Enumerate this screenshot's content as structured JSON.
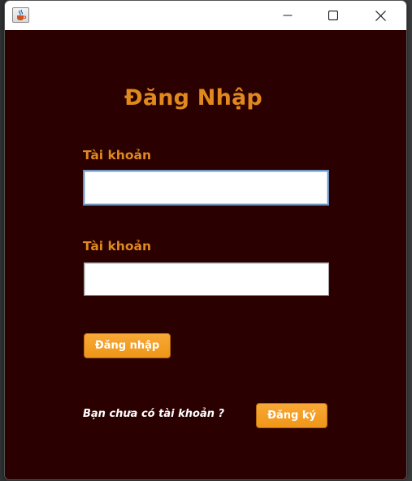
{
  "window": {
    "title": "",
    "icon": "java-cup-icon"
  },
  "titlebar_buttons": [
    "minimize-icon",
    "maximize-icon",
    "close-icon"
  ],
  "form": {
    "heading": "Đăng Nhập",
    "username_label": "Tài khoản",
    "username_value": "",
    "password_label": "Tài khoản",
    "password_value": "",
    "login_button": "Đăng nhập",
    "register_prompt": "Bạn chưa có tài khoản ?",
    "register_button": "Đăng ký"
  },
  "colors": {
    "background": "#2b0000",
    "accent": "#e08a1e",
    "button": "#f29c20",
    "button_text": "#ffffff",
    "prompt_text": "#ffffff"
  }
}
